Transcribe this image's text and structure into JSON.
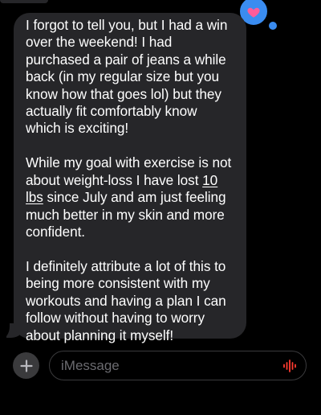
{
  "conversation": {
    "reaction": {
      "icon": "heart-icon",
      "color": "#3a8cf0",
      "heart_color": "#ff5c9a"
    },
    "message": {
      "bubble_color": "#262629",
      "text_color": "#ffffff",
      "paragraph_1": {
        "lines": [
          "I forgot to tell you, but I had a win",
          "over the weekend! I had",
          "purchased a pair of jeans a while",
          "back (in my regular size but you",
          "know how that goes lol) but they",
          "actually fit comfortably know",
          "which is exciting!"
        ]
      },
      "paragraph_2": {
        "line_1": "While my goal with exercise is not",
        "line_2_pre": "about weight-loss I have lost ",
        "line_2_link": "10",
        "line_3_link": "lbs",
        "line_3_post": " since July and am just feeling",
        "line_4": "much better in my skin and more",
        "line_5": "confident."
      },
      "paragraph_3": {
        "lines": [
          "I definitely attribute a lot of this to",
          "being more consistent with my",
          "workouts and having a plan I can",
          "follow without having to worry",
          "about planning it myself!"
        ]
      }
    }
  },
  "composer": {
    "add_icon": "plus-icon",
    "placeholder": "iMessage",
    "audio_icon": "audio-waveform-icon",
    "audio_color": "#ff3b30"
  }
}
